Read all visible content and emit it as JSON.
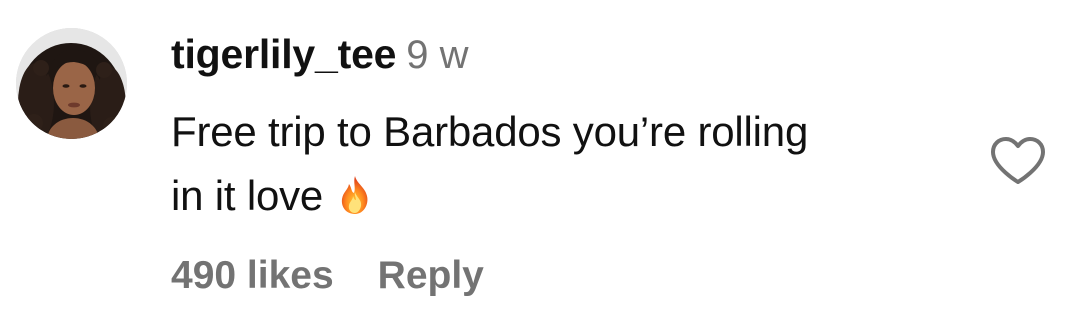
{
  "comment": {
    "username": "tigerlily_tee",
    "timestamp": "9 w",
    "text_line_1": "Free trip to Barbados you’re rolling",
    "text_line_2": "in it love",
    "emoji_icon": "fire-icon",
    "likes": "490 likes",
    "reply_label": "Reply",
    "like_icon": "heart-outline-icon"
  },
  "colors": {
    "primary_text": "#111111",
    "secondary_text": "#737373",
    "background": "#ffffff"
  }
}
